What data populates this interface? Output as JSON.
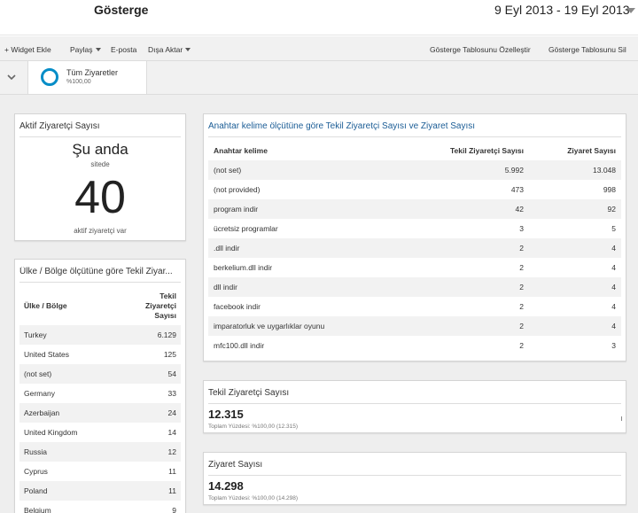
{
  "header": {
    "title": "Gösterge",
    "date_range": "9 Eyl 2013 - 19 Eyl 2013"
  },
  "toolbar": {
    "add_widget": "+ Widget Ekle",
    "share": "Paylaş",
    "email": "E-posta",
    "export": "Dışa Aktar",
    "customize": "Gösterge Tablosunu Özelleştir",
    "delete": "Gösterge Tablosunu Sil"
  },
  "segment": {
    "name": "Tüm Ziyaretler",
    "percent": "%100,00",
    "ring_color": "#058dc7"
  },
  "realtime": {
    "title": "Aktif Ziyaretçi Sayısı",
    "now": "Şu anda",
    "sub": "sitede",
    "count": "40",
    "footer": "aktif ziyaretçi var"
  },
  "keywords": {
    "title": "Anahtar kelime ölçütüne göre Tekil Ziyaretçi Sayısı ve Ziyaret Sayısı",
    "title_color": "#1a5c95",
    "columns": [
      "Anahtar kelime",
      "Tekil Ziyaretçi Sayısı",
      "Ziyaret Sayısı"
    ],
    "rows": [
      [
        "(not set)",
        "5.992",
        "13.048"
      ],
      [
        "(not provided)",
        "473",
        "998"
      ],
      [
        "program indir",
        "42",
        "92"
      ],
      [
        "ücretsiz programlar",
        "3",
        "5"
      ],
      [
        ".dll indir",
        "2",
        "4"
      ],
      [
        "berkelium.dll indir",
        "2",
        "4"
      ],
      [
        "dll indir",
        "2",
        "4"
      ],
      [
        "facebook indir",
        "2",
        "4"
      ],
      [
        "imparatorluk ve uygarlıklar oyunu",
        "2",
        "4"
      ],
      [
        "mfc100.dll indir",
        "2",
        "3"
      ]
    ]
  },
  "countries": {
    "title": "Ülke / Bölge ölçütüne göre Tekil Ziyar...",
    "col_country": "Ülke / Bölge",
    "col_visitors": [
      "Tekil",
      "Ziyaretçi",
      "Sayısı"
    ],
    "rows": [
      [
        "Turkey",
        "6.129"
      ],
      [
        "United States",
        "125"
      ],
      [
        "(not set)",
        "54"
      ],
      [
        "Germany",
        "33"
      ],
      [
        "Azerbaijan",
        "24"
      ],
      [
        "United Kingdom",
        "14"
      ],
      [
        "Russia",
        "12"
      ],
      [
        "Cyprus",
        "11"
      ],
      [
        "Poland",
        "11"
      ],
      [
        "Belgium",
        "9"
      ]
    ]
  },
  "unique_visitors": {
    "title": "Tekil Ziyaretçi Sayısı",
    "value": "12.315",
    "sub": "Toplam Yüzdesi: %100,00 (12.315)"
  },
  "visits": {
    "title": "Ziyaret Sayısı",
    "value": "14.298",
    "sub": "Toplam Yüzdesi: %100,00 (14.298)"
  }
}
